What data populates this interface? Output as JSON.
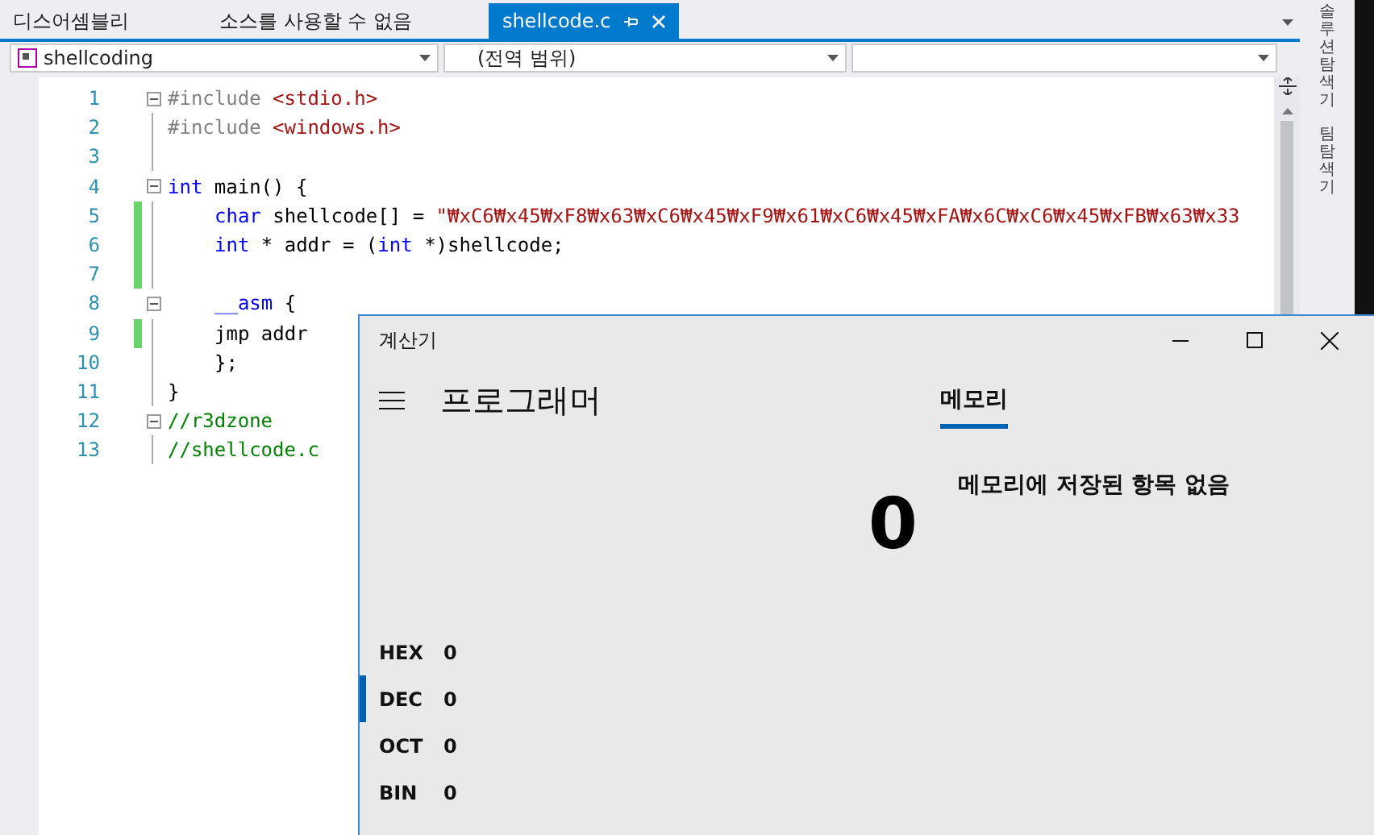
{
  "tabs": [
    {
      "label": "디스어셈블리",
      "selected": false,
      "pinned": false
    },
    {
      "label": "소스를 사용할 수 없음",
      "selected": false,
      "pinned": false
    },
    {
      "label": "shellcode.c",
      "selected": true,
      "pinned": true
    }
  ],
  "nav_bar": {
    "project": "shellcoding",
    "scope": "(전역 범위)"
  },
  "side_panels": [
    "솔루션 탐색기",
    "팀 탐색기"
  ],
  "code_lines": [
    {
      "number": "1",
      "collapsible": true,
      "changed": false,
      "indented": false,
      "tokens": [
        {
          "kind": "preproc",
          "text": "#include "
        },
        {
          "kind": "string",
          "text": "<stdio.h>"
        }
      ]
    },
    {
      "number": "2",
      "collapsible": false,
      "changed": false,
      "indented": false,
      "tokens": [
        {
          "kind": "preproc",
          "text": "#include "
        },
        {
          "kind": "string",
          "text": "<windows.h>"
        }
      ]
    },
    {
      "number": "3",
      "collapsible": false,
      "changed": false
    },
    {
      "number": "4",
      "collapsible": true,
      "changed": false,
      "indented": false,
      "tokens": [
        {
          "kind": "keyword",
          "text": "int"
        },
        {
          "kind": "plain",
          "text": " main() {"
        }
      ]
    },
    {
      "number": "5",
      "collapsible": false,
      "changed": true,
      "indented": true,
      "tokens": [
        {
          "kind": "keyword",
          "text": "char"
        },
        {
          "kind": "plain",
          "text": " shellcode[] = "
        },
        {
          "kind": "string",
          "text": "\"₩xC6₩x45₩xF8₩x63₩xC6₩x45₩xF9₩x61₩xC6₩x45₩xFA₩x6C₩xC6₩x45₩xFB₩x63₩x33"
        }
      ]
    },
    {
      "number": "6",
      "collapsible": false,
      "changed": true,
      "indented": true,
      "tokens": [
        {
          "kind": "keyword",
          "text": "int"
        },
        {
          "kind": "plain",
          "text": " * addr = ("
        },
        {
          "kind": "keyword",
          "text": "int"
        },
        {
          "kind": "plain",
          "text": " *)shellcode;"
        }
      ]
    },
    {
      "number": "7",
      "collapsible": false,
      "changed": true
    },
    {
      "number": "8",
      "collapsible": true,
      "changed": false,
      "indented": true,
      "tokens": [
        {
          "kind": "keyword",
          "text": "__asm"
        },
        {
          "kind": "plain",
          "text": " {"
        }
      ]
    },
    {
      "number": "9",
      "collapsible": false,
      "changed": true,
      "indented": true,
      "tokens": [
        {
          "kind": "plain",
          "text": "jmp addr"
        }
      ]
    },
    {
      "number": "10",
      "collapsible": false,
      "changed": false,
      "indented": true,
      "tokens": [
        {
          "kind": "plain",
          "text": "};"
        }
      ]
    },
    {
      "number": "11",
      "collapsible": false,
      "changed": false,
      "indented": false,
      "tokens": [
        {
          "kind": "plain",
          "text": "}"
        }
      ]
    },
    {
      "number": "12",
      "collapsible": true,
      "changed": false,
      "indented": false,
      "tokens": [
        {
          "kind": "comment",
          "text": "//r3dzone"
        }
      ]
    },
    {
      "number": "13",
      "collapsible": false,
      "changed": false,
      "indented": false,
      "tokens": [
        {
          "kind": "comment",
          "text": "//shellcode.c"
        }
      ]
    }
  ],
  "calculator": {
    "title": "계산기",
    "mode": "프로그래머",
    "memory_tab": {
      "label": "메모리",
      "selected": true
    },
    "display": "0",
    "memory_empty": "메모리에 저장된 항목 없음",
    "bases": [
      {
        "label": "HEX",
        "value": "0",
        "selected": false
      },
      {
        "label": "DEC",
        "value": "0",
        "selected": true
      },
      {
        "label": "OCT",
        "value": "0",
        "selected": false
      },
      {
        "label": "BIN",
        "value": "0",
        "selected": false
      }
    ]
  }
}
